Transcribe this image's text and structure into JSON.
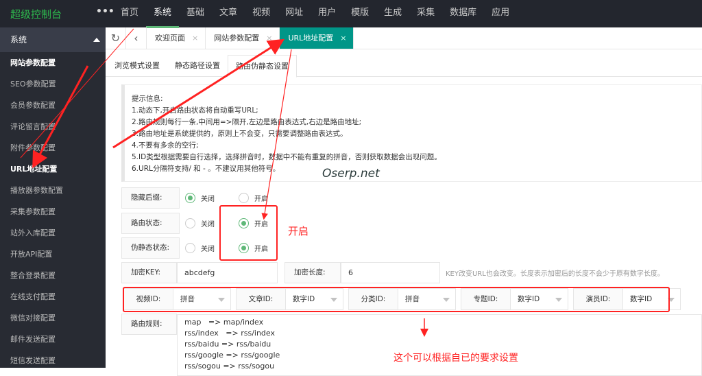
{
  "app_title": "超级控制台",
  "top_nav": [
    "首页",
    "系统",
    "基础",
    "文章",
    "视频",
    "网址",
    "用户",
    "模版",
    "生成",
    "采集",
    "数据库",
    "应用"
  ],
  "top_nav_active": 1,
  "sidebar": {
    "header": "系统",
    "items": [
      "网站参数配置",
      "SEO参数配置",
      "会员参数配置",
      "评论留言配置",
      "附件参数配置",
      "URL地址配置",
      "播放器参数配置",
      "采集参数配置",
      "站外入库配置",
      "开放API配置",
      "整合登录配置",
      "在线支付配置",
      "微信对接配置",
      "邮件发送配置",
      "短信发送配置"
    ],
    "active": 5
  },
  "tabs": [
    {
      "label": "欢迎页面"
    },
    {
      "label": "网站参数配置"
    },
    {
      "label": "URL地址配置"
    }
  ],
  "subtabs": [
    "浏览模式设置",
    "静态路径设置",
    "路由伪静态设置"
  ],
  "info": {
    "title": "提示信息:",
    "lines": [
      "1.动态下,开启路由状态将自动重写URL;",
      "2.路由规则每行一条,中间用=>隔开,左边是路由表达式,右边是路由地址;",
      "3.路由地址是系统提供的，原则上不会变，只需要调整路由表达式。",
      "4.不要有多余的空行;",
      "5.ID类型根据需要自行选择，选择拼音时，数据中不能有重复的拼音，否则获取数据会出现问题。",
      "6.URL分隔符支持/ 和 - 。不建议用其他符号。"
    ]
  },
  "watermark": "Oserp.net",
  "options": {
    "off": "关闭",
    "on": "开启"
  },
  "hide_suffix": {
    "label": "隐藏后缀:",
    "value": "关闭"
  },
  "route_status": {
    "label": "路由状态:",
    "value": "开启"
  },
  "rewrite_status": {
    "label": "伪静态状态:",
    "value": "开启"
  },
  "encrypt_key": {
    "label": "加密KEY:",
    "value": "abcdefg"
  },
  "encrypt_len": {
    "label": "加密长度:",
    "value": "6"
  },
  "encrypt_hint": "KEY改变URL也会改变。长度表示加密后的长度不会少于原有数字长度。",
  "id_types": [
    {
      "label": "视频ID:",
      "value": "拼音"
    },
    {
      "label": "文章ID:",
      "value": "数字ID"
    },
    {
      "label": "分类ID:",
      "value": "拼音"
    },
    {
      "label": "专题ID:",
      "value": "数字ID"
    },
    {
      "label": "演员ID:",
      "value": "数字ID"
    }
  ],
  "route_rules": {
    "label": "路由规则:",
    "value": "map   => map/index\nrss/index   => rss/index\nrss/baidu => rss/baidu\nrss/google => rss/google\nrss/sogou => rss/sogou"
  },
  "annotations": {
    "open": "开启",
    "caption": "这个可以根据自已的要求设置"
  }
}
